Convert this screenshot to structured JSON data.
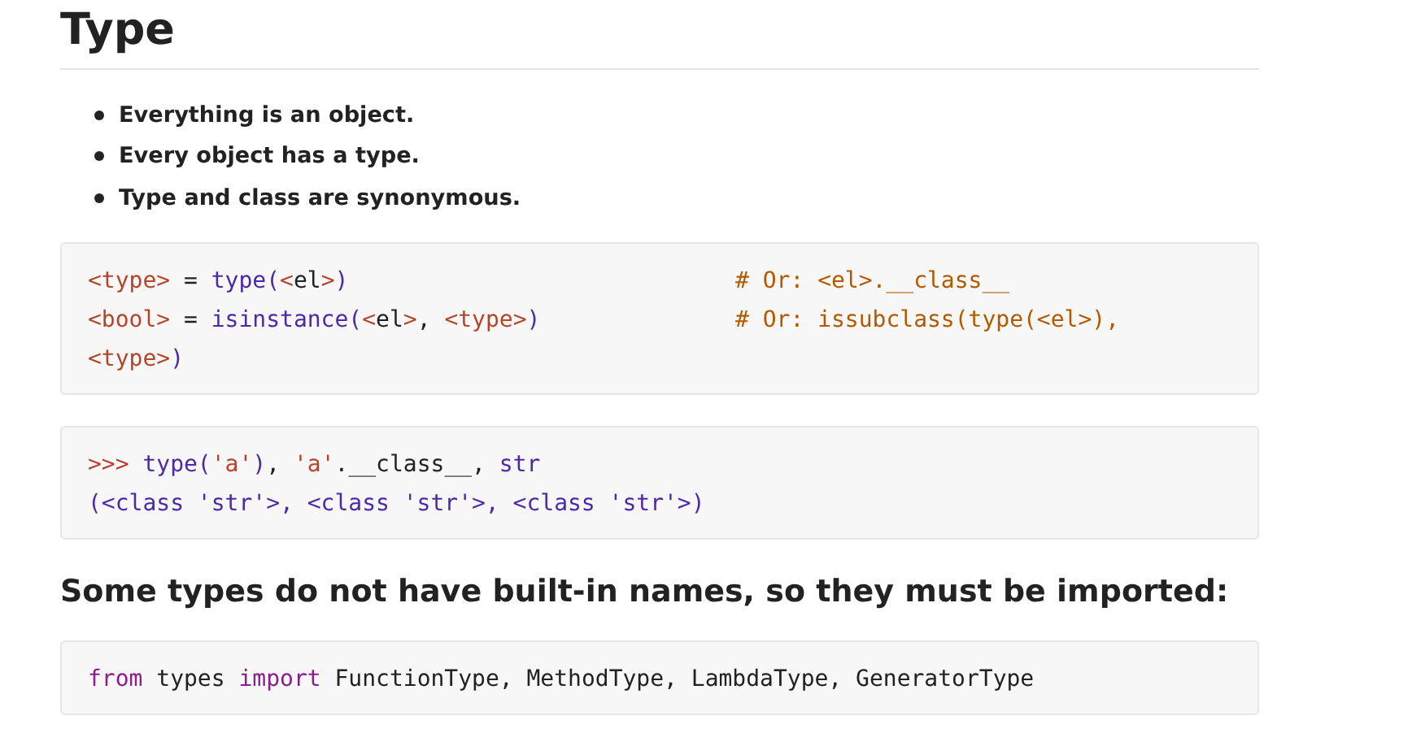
{
  "title": "Type",
  "bullets": [
    "Everything is an object.",
    "Every object has a type.",
    "Type and class are synonymous."
  ],
  "code_blocks": [
    {
      "lines": [
        {
          "tokens": [
            {
              "kind": "var",
              "text": "<type>"
            },
            {
              "kind": "plain",
              "text": " = "
            },
            {
              "kind": "builtin",
              "text": "type("
            },
            {
              "kind": "var",
              "text": "<"
            },
            {
              "kind": "plain",
              "text": "el"
            },
            {
              "kind": "var",
              "text": ">"
            },
            {
              "kind": "builtin",
              "text": ")"
            }
          ],
          "comment": "# Or: <el>.__class__"
        },
        {
          "tokens": [
            {
              "kind": "var",
              "text": "<bool>"
            },
            {
              "kind": "plain",
              "text": " = "
            },
            {
              "kind": "builtin",
              "text": "isinstance("
            },
            {
              "kind": "var",
              "text": "<"
            },
            {
              "kind": "plain",
              "text": "el"
            },
            {
              "kind": "var",
              "text": ">"
            },
            {
              "kind": "plain",
              "text": ", "
            },
            {
              "kind": "var",
              "text": "<type>"
            },
            {
              "kind": "builtin",
              "text": ")"
            }
          ],
          "comment": "# Or: issubclass(type(<el>),"
        },
        {
          "tokens": [
            {
              "kind": "var",
              "text": "<type>"
            },
            {
              "kind": "builtin",
              "text": ")"
            }
          ]
        }
      ]
    },
    {
      "lines": [
        {
          "tokens": [
            {
              "kind": "prompt",
              "text": ">>> "
            },
            {
              "kind": "builtin",
              "text": "type("
            },
            {
              "kind": "string",
              "text": "'a'"
            },
            {
              "kind": "builtin",
              "text": ")"
            },
            {
              "kind": "plain",
              "text": ", "
            },
            {
              "kind": "string",
              "text": "'a'"
            },
            {
              "kind": "plain",
              "text": ".__class__, "
            },
            {
              "kind": "builtin",
              "text": "str"
            }
          ]
        },
        {
          "tokens": [
            {
              "kind": "builtin",
              "text": "(<class 'str'>, <class 'str'>, <class 'str'>)"
            }
          ]
        }
      ]
    }
  ],
  "subheading": "Some types do not have built-in names, so they must be imported:",
  "import_block": {
    "lines": [
      {
        "tokens": [
          {
            "kind": "keyword",
            "text": "from"
          },
          {
            "kind": "plain",
            "text": " types "
          },
          {
            "kind": "keyword",
            "text": "import"
          },
          {
            "kind": "plain",
            "text": " FunctionType, MethodType, LambdaType, GeneratorType"
          }
        ]
      }
    ]
  }
}
